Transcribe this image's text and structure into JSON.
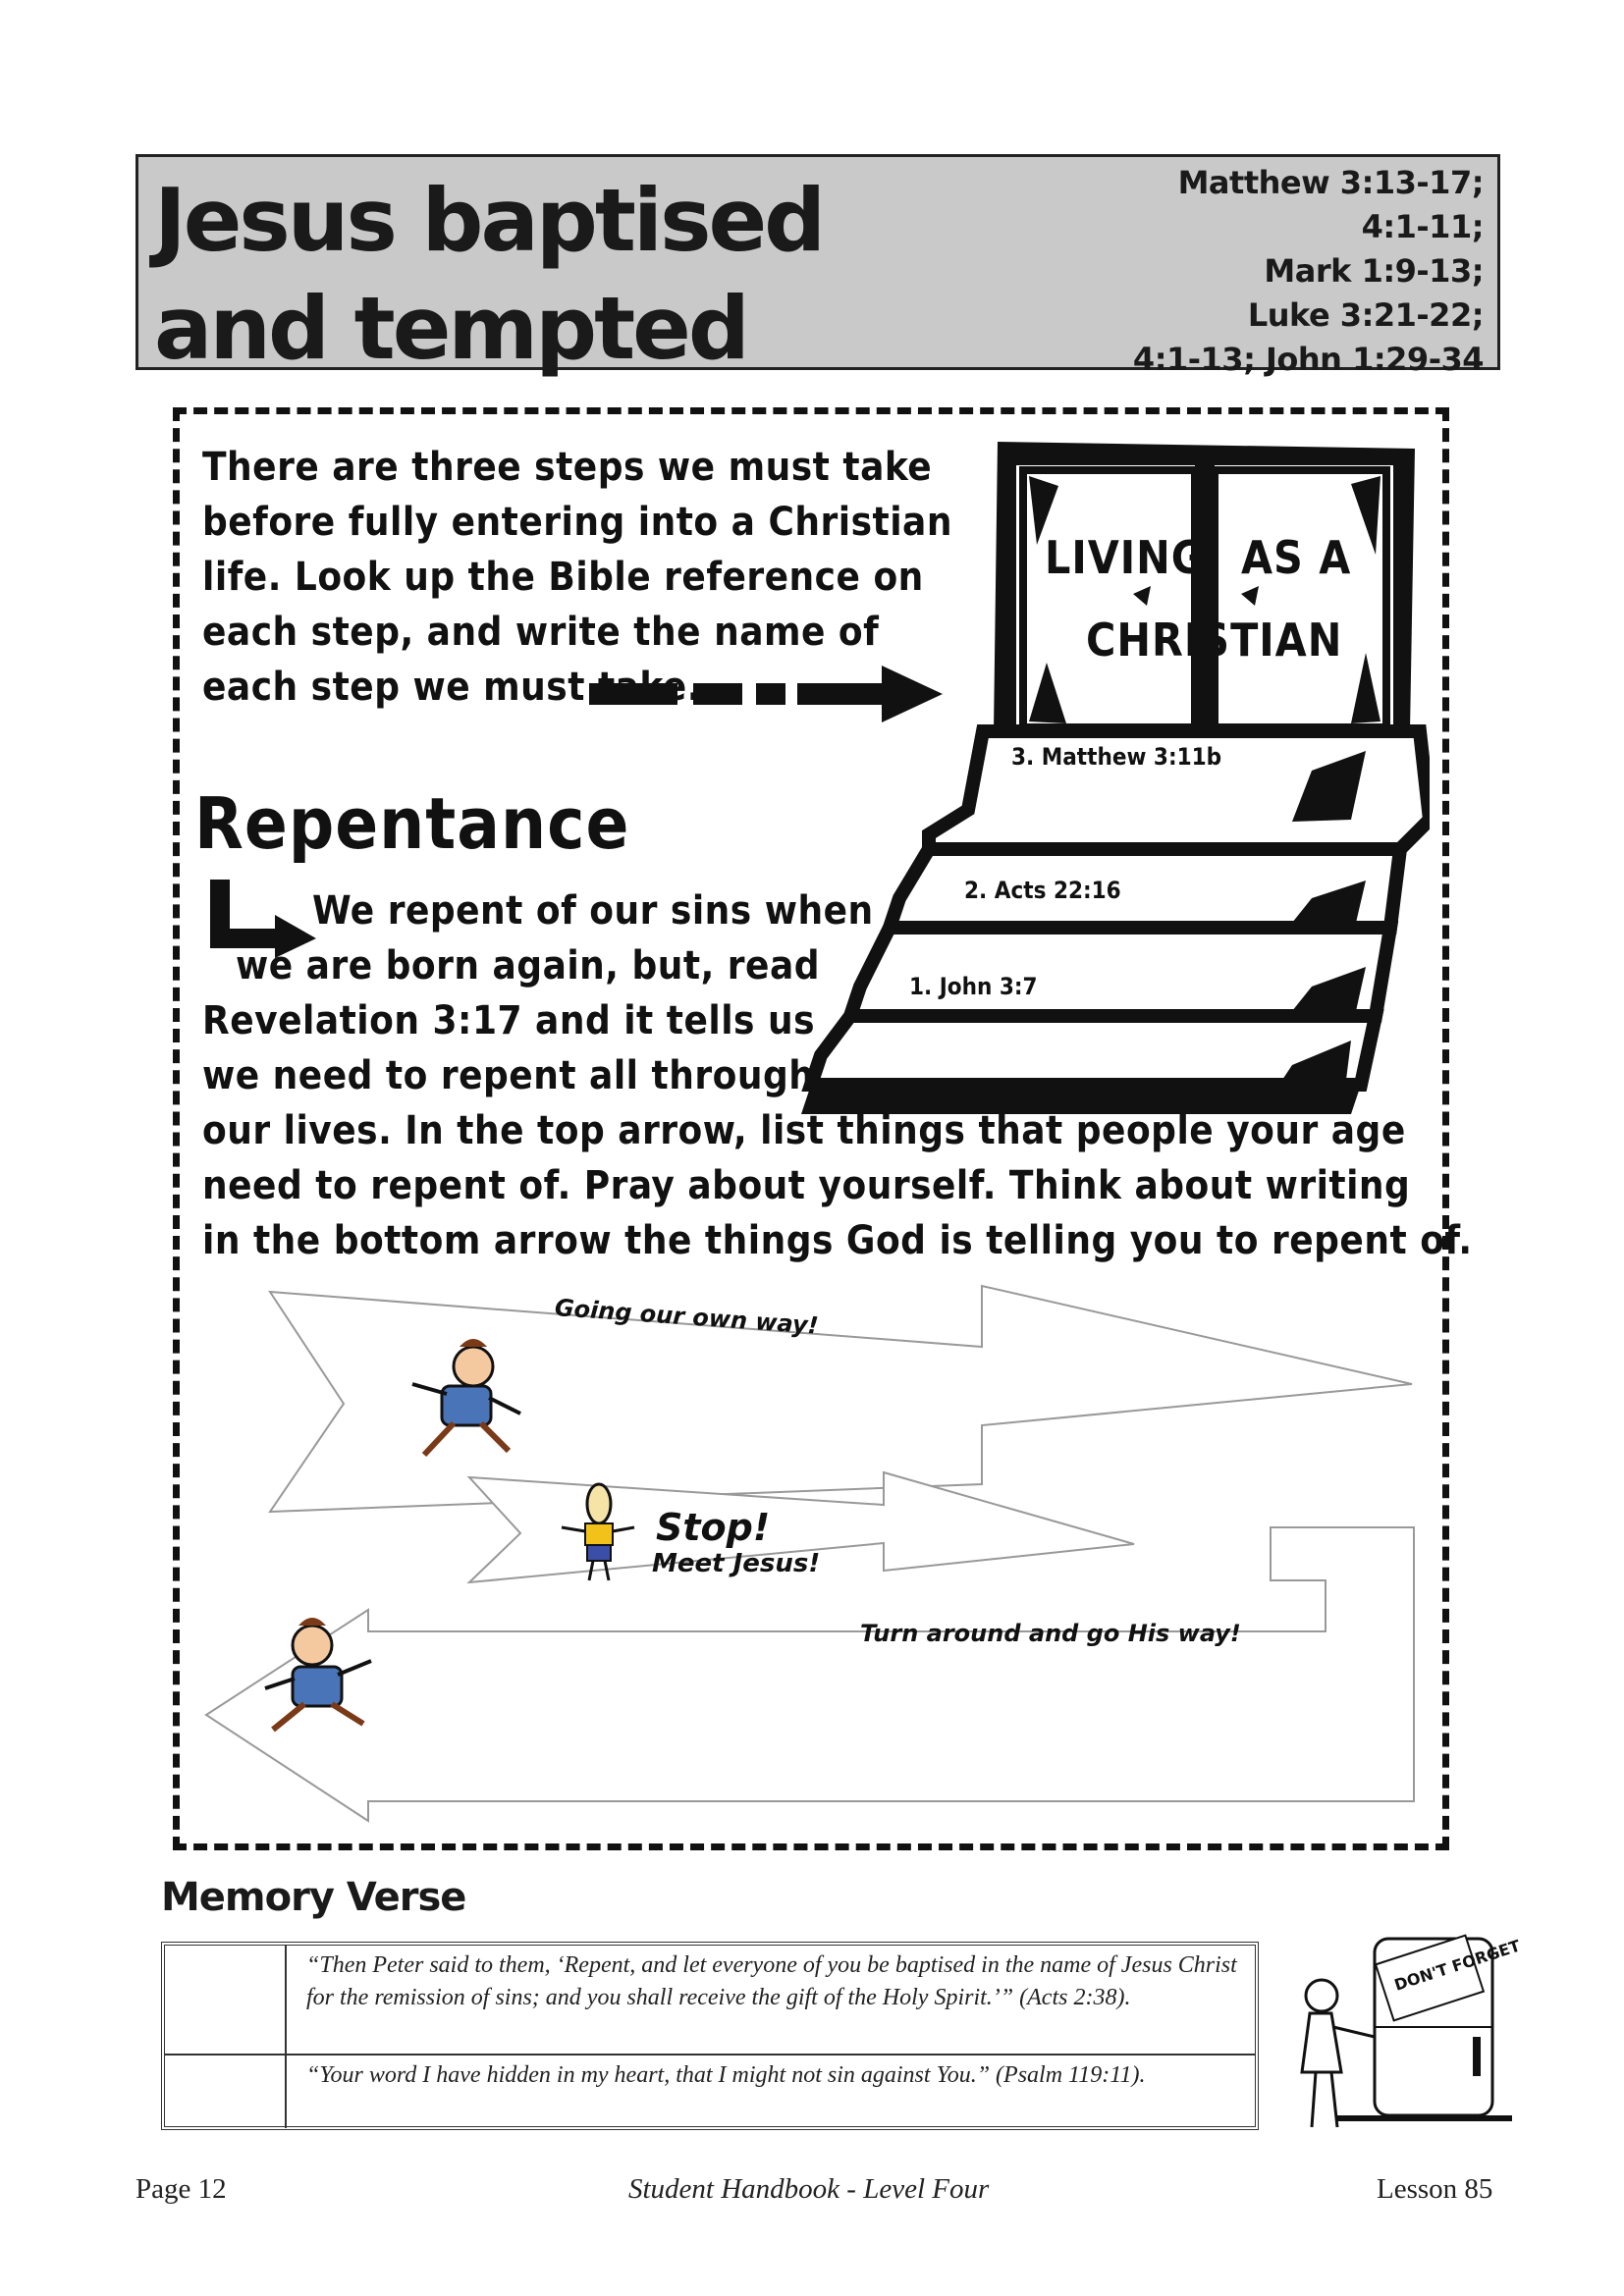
{
  "header": {
    "title_line1": "Jesus baptised",
    "title_line2": "and tempted",
    "refs": [
      "Matthew 3:13-17;",
      "4:1-11;",
      "Mark 1:9-13;",
      "Luke 3:21-22;",
      "4:1-13; John 1:29-34"
    ]
  },
  "intro": "There are three steps we must take before fully entering into a Christian life.  Look up the Bible reference on each step, and write the name of each step we must take.",
  "door": {
    "word1": "LIVING",
    "word2": "AS A",
    "word3": "CHRISTIAN"
  },
  "steps": {
    "step3": "3. Matthew 3:11b",
    "step2": "2. Acts 22:16",
    "step1": "1. John 3:7"
  },
  "repentance": {
    "heading": "Repentance",
    "lines": [
      "We repent of our sins when",
      "we are born again, but, read",
      "Revelation 3:17 and it tells us",
      "we need to repent all through",
      "our lives.  In the top arrow, list things that people your age",
      "need to repent of.  Pray about yourself.  Think about writing",
      "in the bottom arrow the things God is telling you to repent of."
    ]
  },
  "arrows": {
    "top_caption": "Going our own way!",
    "stop_title": "Stop!",
    "stop_sub": "Meet Jesus!",
    "turn_caption": "Turn around and go His way!"
  },
  "memory_verse": {
    "heading": "Memory Verse",
    "verses": [
      "“Then Peter said to them, ‘Repent, and let everyone of you be baptised in the name of Jesus Christ for the remission of sins; and you shall receive the gift of the Holy Spirit.’”  (Acts 2:38).",
      "“Your word I have hidden in my heart, that I might not sin against You.” (Psalm 119:11)."
    ],
    "fridge_note": "DON'T FORGET"
  },
  "footer": {
    "left": "Page 12",
    "center": "Student Handbook - Level Four",
    "right": "Lesson 85"
  }
}
